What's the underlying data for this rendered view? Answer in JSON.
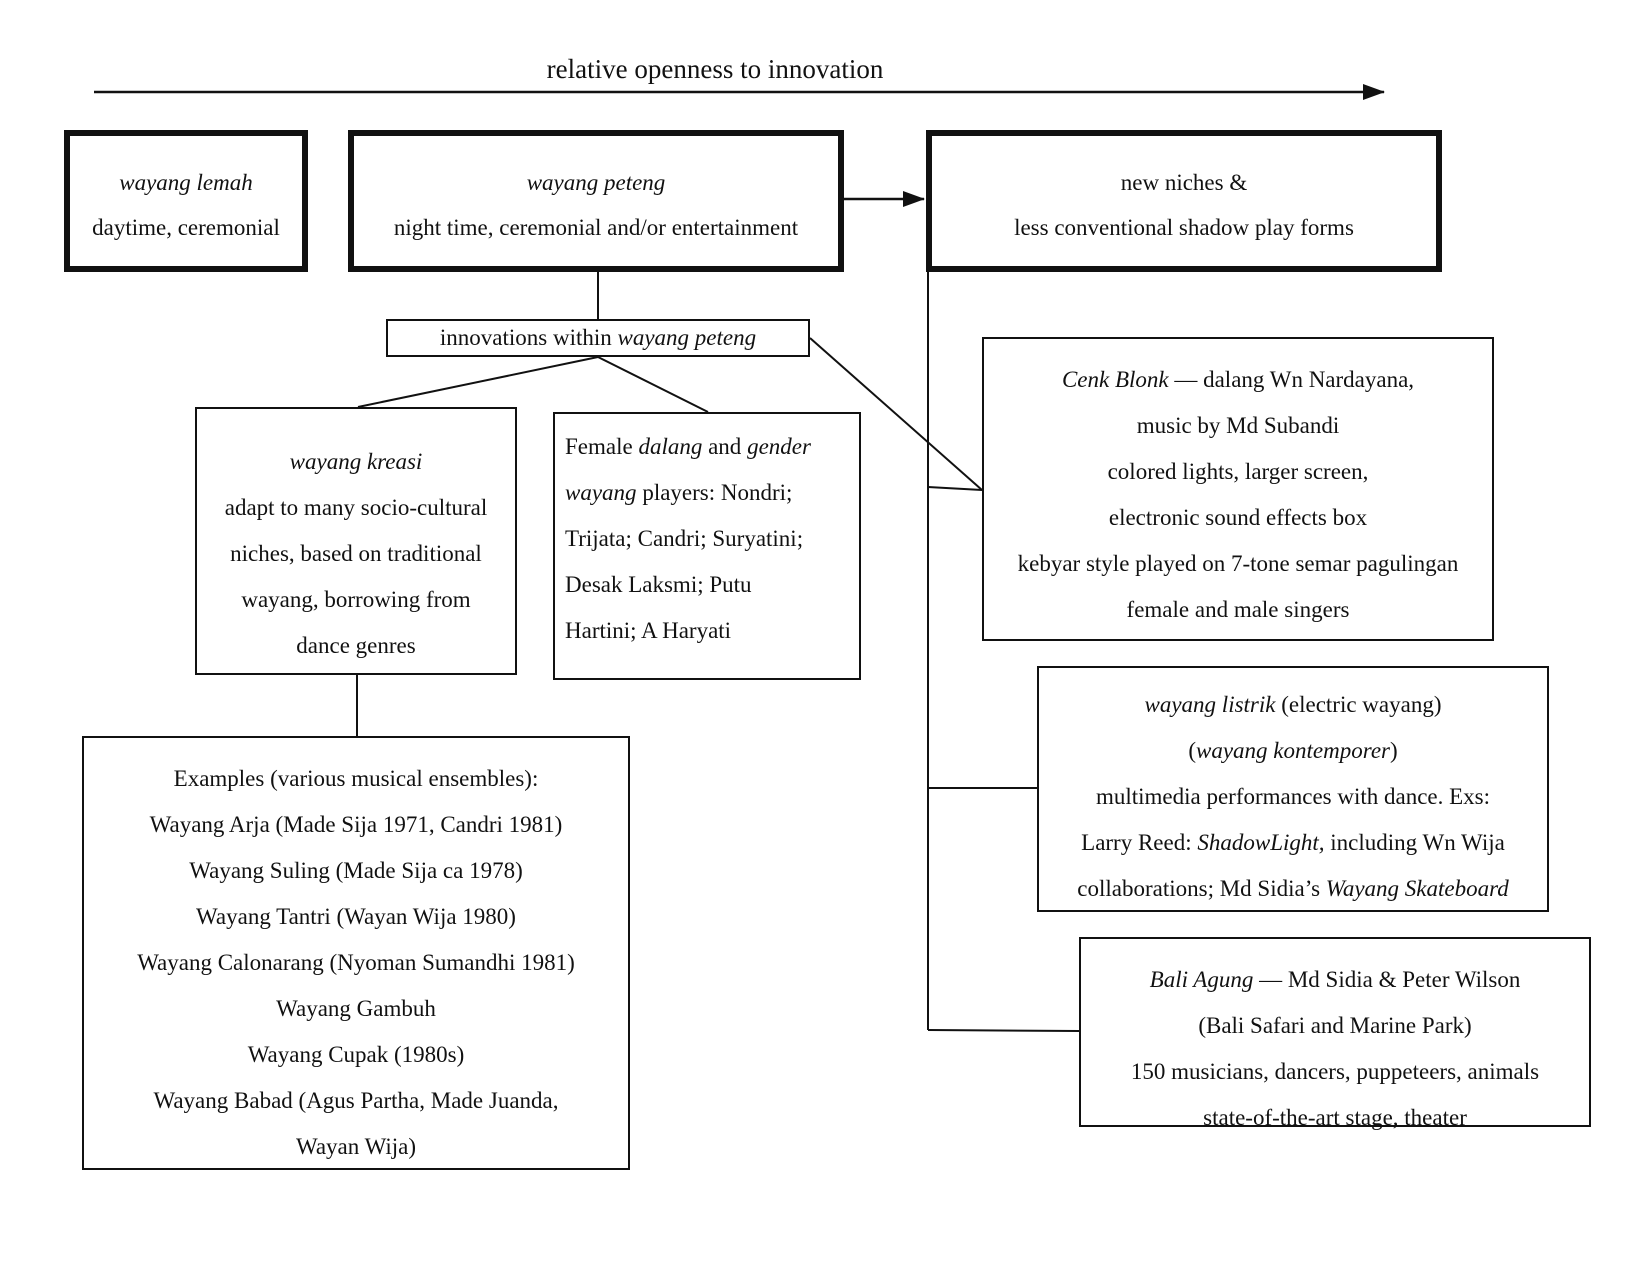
{
  "axis": {
    "label": "relative openness to innovation",
    "direction": "left-to-right"
  },
  "nodes": {
    "wayang_lemah": {
      "title": "wayang lemah",
      "desc": "daytime, ceremonial"
    },
    "wayang_peteng": {
      "title": "wayang peteng",
      "desc": "night time, ceremonial and/or entertainment"
    },
    "new_niches": {
      "line1": "new niches &",
      "line2": "less conventional shadow play forms"
    },
    "innovations": {
      "prefix": "innovations within ",
      "italic": "wayang peteng"
    },
    "wayang_kreasi": {
      "title": "wayang kreasi",
      "lines": [
        "adapt to many socio-cultural",
        "niches, based on traditional",
        "wayang, borrowing from",
        "dance genres"
      ]
    },
    "female_dalang": {
      "l1_a": "Female ",
      "l1_b": "dalang",
      "l1_c": " and ",
      "l1_d": "gender",
      "l2_a": "wayang",
      "l2_b": " players: Nondri;",
      "l3": "Trijata; Candri; Suryatini;",
      "l4": "Desak Laksmi; Putu",
      "l5": "Hartini; A Haryati"
    },
    "examples": {
      "heading": "Examples (various musical ensembles):",
      "items": [
        "Wayang Arja (Made Sija 1971, Candri 1981)",
        "Wayang Suling (Made Sija ca 1978)",
        "Wayang Tantri (Wayan Wija 1980)",
        "Wayang Calonarang (Nyoman Sumandhi 1981)",
        "Wayang Gambuh",
        "Wayang Cupak (1980s)",
        "Wayang Babad (Agus Partha, Made Juanda,",
        "Wayan Wija)"
      ]
    },
    "cenk_blonk": {
      "title": "Cenk Blonk",
      "title_rest": " — dalang Wn Nardayana,",
      "lines": [
        "music by Md Subandi",
        "colored lights, larger screen,",
        "electronic sound effects box",
        "kebyar style played on 7-tone semar pagulingan",
        "female and male singers"
      ]
    },
    "wayang_listrik": {
      "title": "wayang listrik",
      "title_rest": " (electric wayang)",
      "l2_open": "(",
      "l2_italic": "wayang kontemporer",
      "l2_close": ")",
      "l3": "multimedia performances with dance. Exs:",
      "l4_a": "Larry Reed: ",
      "l4_b": "ShadowLight,",
      "l4_c": " including Wn Wija",
      "l5_a": "collaborations; Md Sidia’s ",
      "l5_b": "Wayang Skateboard"
    },
    "bali_agung": {
      "title": "Bali Agung",
      "title_rest": " — Md Sidia & Peter Wilson",
      "lines": [
        "(Bali Safari and Marine Park)",
        "150 musicians, dancers, puppeteers, animals",
        "state-of-the-art stage, theater"
      ]
    }
  },
  "edges": [
    {
      "from": "wayang_peteng",
      "to": "new_niches",
      "type": "arrow"
    },
    {
      "from": "wayang_peteng",
      "to": "innovations",
      "type": "line"
    },
    {
      "from": "innovations",
      "to": "wayang_kreasi",
      "type": "line"
    },
    {
      "from": "innovations",
      "to": "female_dalang",
      "type": "line"
    },
    {
      "from": "innovations",
      "to": "cenk_blonk",
      "type": "line"
    },
    {
      "from": "wayang_kreasi",
      "to": "examples",
      "type": "line"
    },
    {
      "from": "new_niches",
      "to": "cenk_blonk",
      "type": "line"
    },
    {
      "from": "new_niches",
      "to": "wayang_listrik",
      "type": "line"
    },
    {
      "from": "new_niches",
      "to": "bali_agung",
      "type": "line"
    }
  ]
}
